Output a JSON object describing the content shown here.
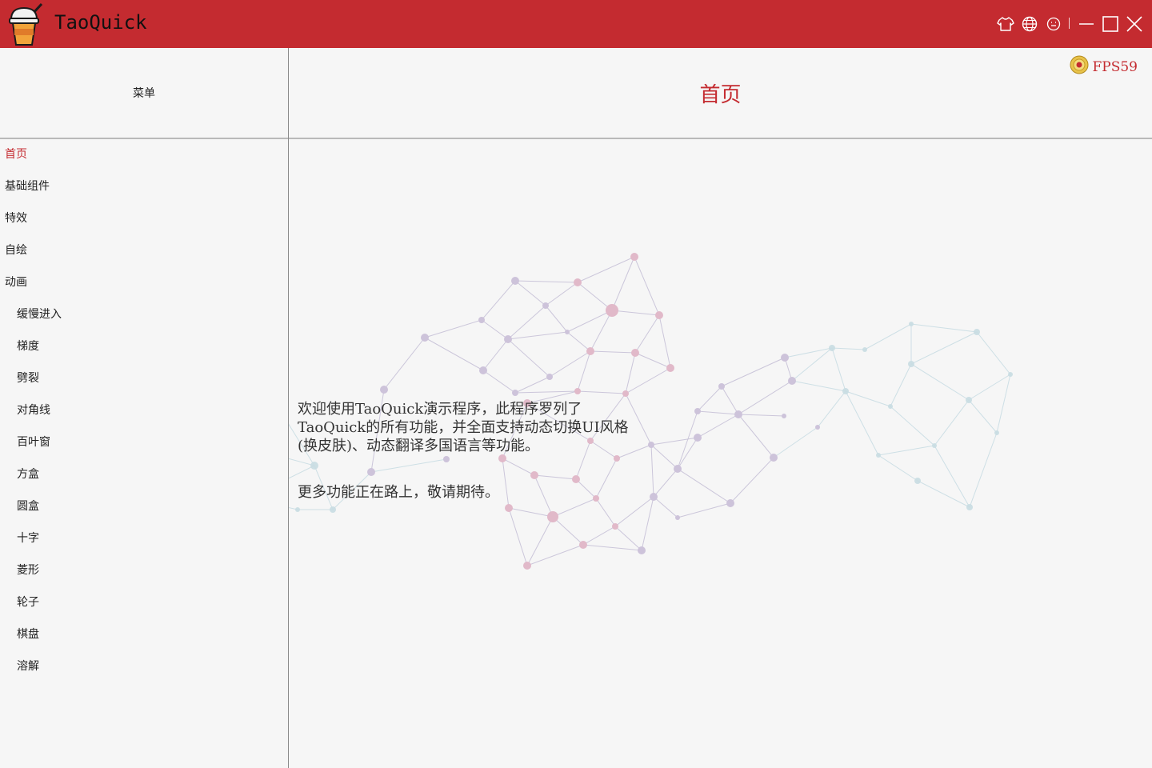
{
  "window": {
    "title": "TaoQuick",
    "controls": [
      {
        "name": "skin-icon"
      },
      {
        "name": "language-icon"
      },
      {
        "name": "smile-icon"
      },
      {
        "name": "minimize-icon"
      },
      {
        "name": "maximize-icon"
      },
      {
        "name": "close-icon"
      }
    ]
  },
  "sidebar": {
    "header": "菜单",
    "items": [
      {
        "label": "首页",
        "active": true,
        "level": 0
      },
      {
        "label": "基础组件",
        "level": 0
      },
      {
        "label": "特效",
        "level": 0
      },
      {
        "label": "自绘",
        "level": 0
      },
      {
        "label": "动画",
        "level": 0
      },
      {
        "label": "缓慢进入",
        "level": 1
      },
      {
        "label": "梯度",
        "level": 1
      },
      {
        "label": "劈裂",
        "level": 1
      },
      {
        "label": "对角线",
        "level": 1
      },
      {
        "label": "百叶窗",
        "level": 1
      },
      {
        "label": "方盒",
        "level": 1
      },
      {
        "label": "圆盒",
        "level": 1
      },
      {
        "label": "十字",
        "level": 1
      },
      {
        "label": "菱形",
        "level": 1
      },
      {
        "label": "轮子",
        "level": 1
      },
      {
        "label": "棋盘",
        "level": 1
      },
      {
        "label": "溶解",
        "level": 1
      }
    ]
  },
  "main": {
    "title": "首页",
    "fps_label": "FPS59",
    "welcome_lines": [
      "欢迎使用TaoQuick演示程序，此程序罗列了",
      "TaoQuick的所有功能，并全面支持动态切换UI风格",
      "(换皮肤)、动态翻译多国语言等功能。"
    ],
    "more_text": "更多功能正在路上，敬请期待。"
  },
  "colors": {
    "accent": "#c42b30",
    "background": "#f6f6f6",
    "divider": "#b9b9b9"
  }
}
